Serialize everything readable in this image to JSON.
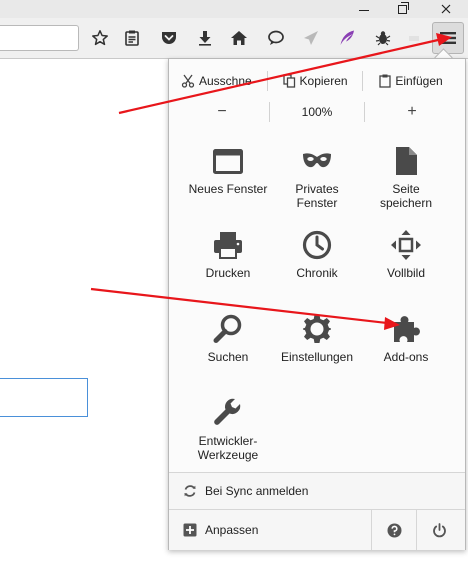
{
  "window": {
    "controls": [
      "minimize",
      "maximize",
      "close"
    ]
  },
  "toolbar": {
    "icons": [
      "star-icon",
      "reading-list-icon",
      "pocket-icon",
      "download-icon",
      "home-icon",
      "chat-icon",
      "send-icon",
      "feather-icon",
      "bug-icon"
    ]
  },
  "menu": {
    "edit": {
      "cut": "Ausschne",
      "copy": "Kopieren",
      "paste": "Einfügen"
    },
    "zoom": {
      "minus": "−",
      "level": "100%",
      "plus": "+"
    },
    "tiles": [
      {
        "label": "Neues Fenster",
        "icon": "new-window-icon"
      },
      {
        "label": "Privates Fenster",
        "icon": "private-mask-icon"
      },
      {
        "label": "Seite speichern",
        "icon": "save-page-icon"
      },
      {
        "label": "Drucken",
        "icon": "printer-icon"
      },
      {
        "label": "Chronik",
        "icon": "clock-icon"
      },
      {
        "label": "Vollbild",
        "icon": "fullscreen-icon"
      },
      {
        "label": "Suchen",
        "icon": "magnifier-icon"
      },
      {
        "label": "Einstellungen",
        "icon": "gear-icon"
      },
      {
        "label": "Add-ons",
        "icon": "puzzle-icon"
      },
      {
        "label": "Entwickler-Werkzeuge",
        "icon": "wrench-icon"
      }
    ],
    "sync": "Bei Sync anmelden",
    "customize": "Anpassen"
  },
  "colors": {
    "arrow": "#e8161b",
    "icon": "#4a4a4a",
    "focus": "#4a90d9"
  }
}
